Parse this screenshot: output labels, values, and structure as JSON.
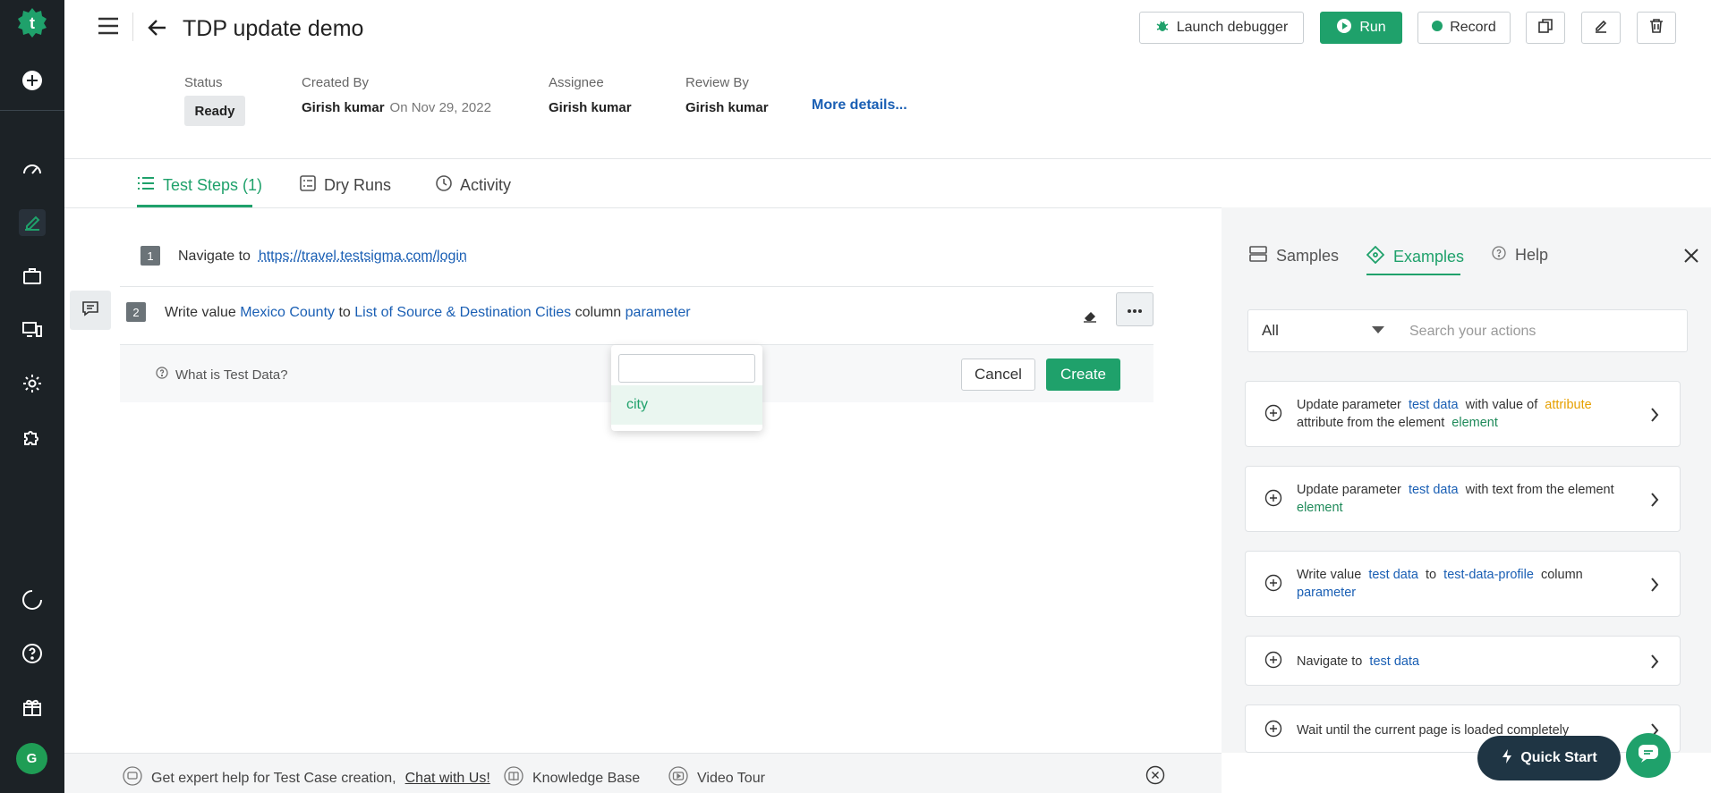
{
  "header": {
    "title": "TDP update demo",
    "buttons": {
      "launch_debugger": "Launch debugger",
      "run": "Run",
      "record": "Record"
    }
  },
  "meta": {
    "status_label": "Status",
    "status_value": "Ready",
    "created_by_label": "Created By",
    "created_by_value": "Girish kumar",
    "created_on": "On Nov 29, 2022",
    "assignee_label": "Assignee",
    "assignee_value": "Girish kumar",
    "review_by_label": "Review By",
    "review_by_value": "Girish kumar",
    "more_details": "More details..."
  },
  "tabs": [
    {
      "label": "Test Steps (1)",
      "active": true
    },
    {
      "label": "Dry Runs",
      "active": false
    },
    {
      "label": "Activity",
      "active": false
    }
  ],
  "steps": [
    {
      "num": "1",
      "prefix": "Navigate to",
      "url": "https://travel.testsigma.com/login"
    },
    {
      "num": "2",
      "w1": "Write value",
      "v1": "Mexico County",
      "w2": "to",
      "v2": "List of Source & Destination Cities",
      "w3": "column",
      "v3": "parameter"
    }
  ],
  "test_data_panel": {
    "help": "What is Test Data?",
    "cancel": "Cancel",
    "create": "Create"
  },
  "dropdown": {
    "search_value": "",
    "options": [
      "city"
    ]
  },
  "right_panel": {
    "tabs": [
      {
        "label": "Samples",
        "active": false
      },
      {
        "label": "Examples",
        "active": true
      },
      {
        "label": "Help",
        "active": false
      }
    ],
    "filter_value": "All",
    "search_placeholder": "Search your actions",
    "cards": [
      {
        "a": "Update parameter",
        "b": "test data",
        "c": "with value of",
        "d": "attribute",
        "e": "attribute from the element",
        "f": "element"
      },
      {
        "a": "Update parameter",
        "b": "test data",
        "c": "with text from the element",
        "d": "element"
      },
      {
        "a": "Write value",
        "b": "test data",
        "c": "to",
        "d": "test-data-profile",
        "e": "column",
        "f": "parameter"
      },
      {
        "a": "Navigate to",
        "b": "test data"
      },
      {
        "a": "Wait until the current page is loaded completely"
      }
    ]
  },
  "footer": {
    "help_text": "Get expert help for Test Case creation,",
    "chat_link": "Chat with Us!",
    "knowledge_base": "Knowledge Base",
    "video_tour": "Video Tour"
  },
  "quick_start": "Quick Start",
  "user_initial": "G",
  "colors": {
    "accent": "#1fa16b",
    "sidebar": "#1c2226",
    "link": "#1a5fb4",
    "warning": "#e6a000"
  }
}
